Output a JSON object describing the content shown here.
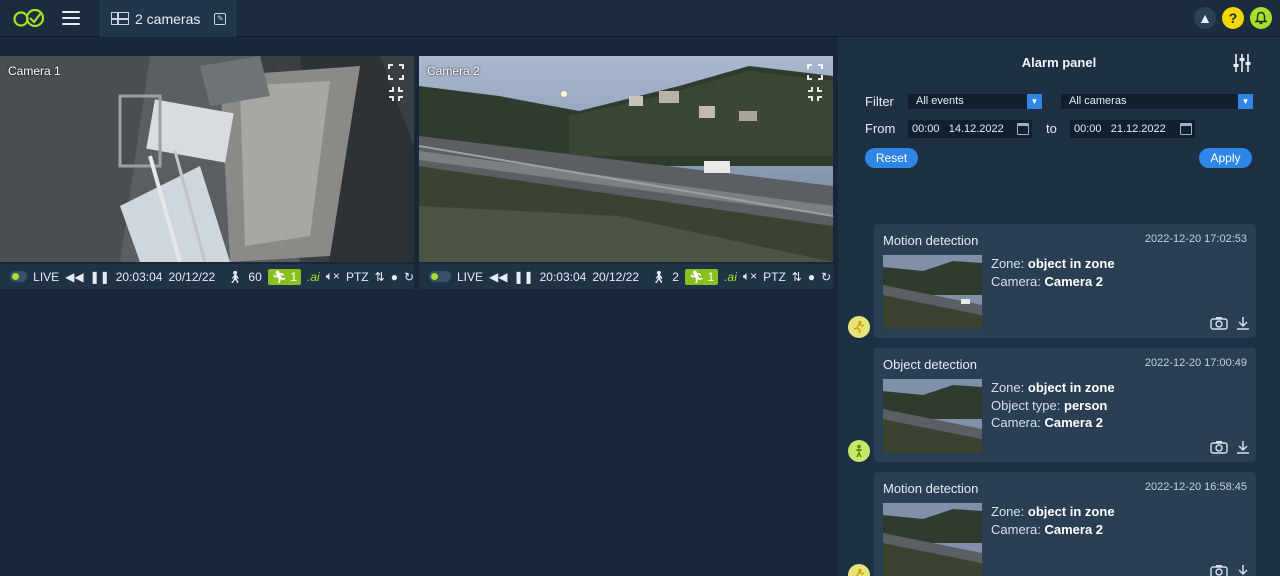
{
  "topbar": {
    "tab_label": "2 cameras"
  },
  "cameras": [
    {
      "name": "Camera 1",
      "live_label": "LIVE",
      "time": "20:03:04",
      "date": "20/12/22",
      "person_count": "60",
      "motion_count": "1",
      "ai_label": ".ai",
      "ptz_label": "PTZ"
    },
    {
      "name": "Camera 2",
      "live_label": "LIVE",
      "time": "20:03:04",
      "date": "20/12/22",
      "person_count": "2",
      "motion_count": "1",
      "ai_label": ".ai",
      "ptz_label": "PTZ"
    }
  ],
  "alarm_panel": {
    "title": "Alarm panel",
    "filter_label": "Filter",
    "event_filter": "All events",
    "camera_filter": "All cameras",
    "from_label": "From",
    "from_time": "00:00",
    "from_date": "14.12.2022",
    "to_label": "to",
    "to_time": "00:00",
    "to_date": "21.12.2022",
    "reset_label": "Reset",
    "apply_label": "Apply",
    "events": [
      {
        "type": "Motion detection",
        "timestamp": "2022-12-20 17:02:53",
        "zone_label": "Zone:",
        "zone_value": "object in zone",
        "camera_label": "Camera:",
        "camera_value": "Camera 2"
      },
      {
        "type": "Object detection",
        "timestamp": "2022-12-20 17:00:49",
        "zone_label": "Zone:",
        "zone_value": "object in zone",
        "object_label": "Object type:",
        "object_value": "person",
        "camera_label": "Camera:",
        "camera_value": "Camera 2"
      },
      {
        "type": "Motion detection",
        "timestamp": "2022-12-20 16:58:45",
        "zone_label": "Zone:",
        "zone_value": "object in zone",
        "camera_label": "Camera:",
        "camera_value": "Camera 2"
      }
    ]
  },
  "colors": {
    "accent": "#2e86e6",
    "brand_green": "#a7e026",
    "help_yellow": "#f2d600",
    "background": "#17283a"
  },
  "icons": [
    "logo-icon",
    "menu-icon",
    "grid-icon",
    "edit-icon",
    "collapse-icon",
    "help-icon",
    "bell-icon",
    "expand-icon",
    "fit-icon",
    "rewind-icon",
    "pause-icon",
    "person-icon",
    "motion-icon",
    "mute-icon",
    "adjust-icon",
    "location-icon",
    "refresh-icon",
    "sliders-icon",
    "calendar-icon",
    "snapshot-icon",
    "download-icon"
  ]
}
